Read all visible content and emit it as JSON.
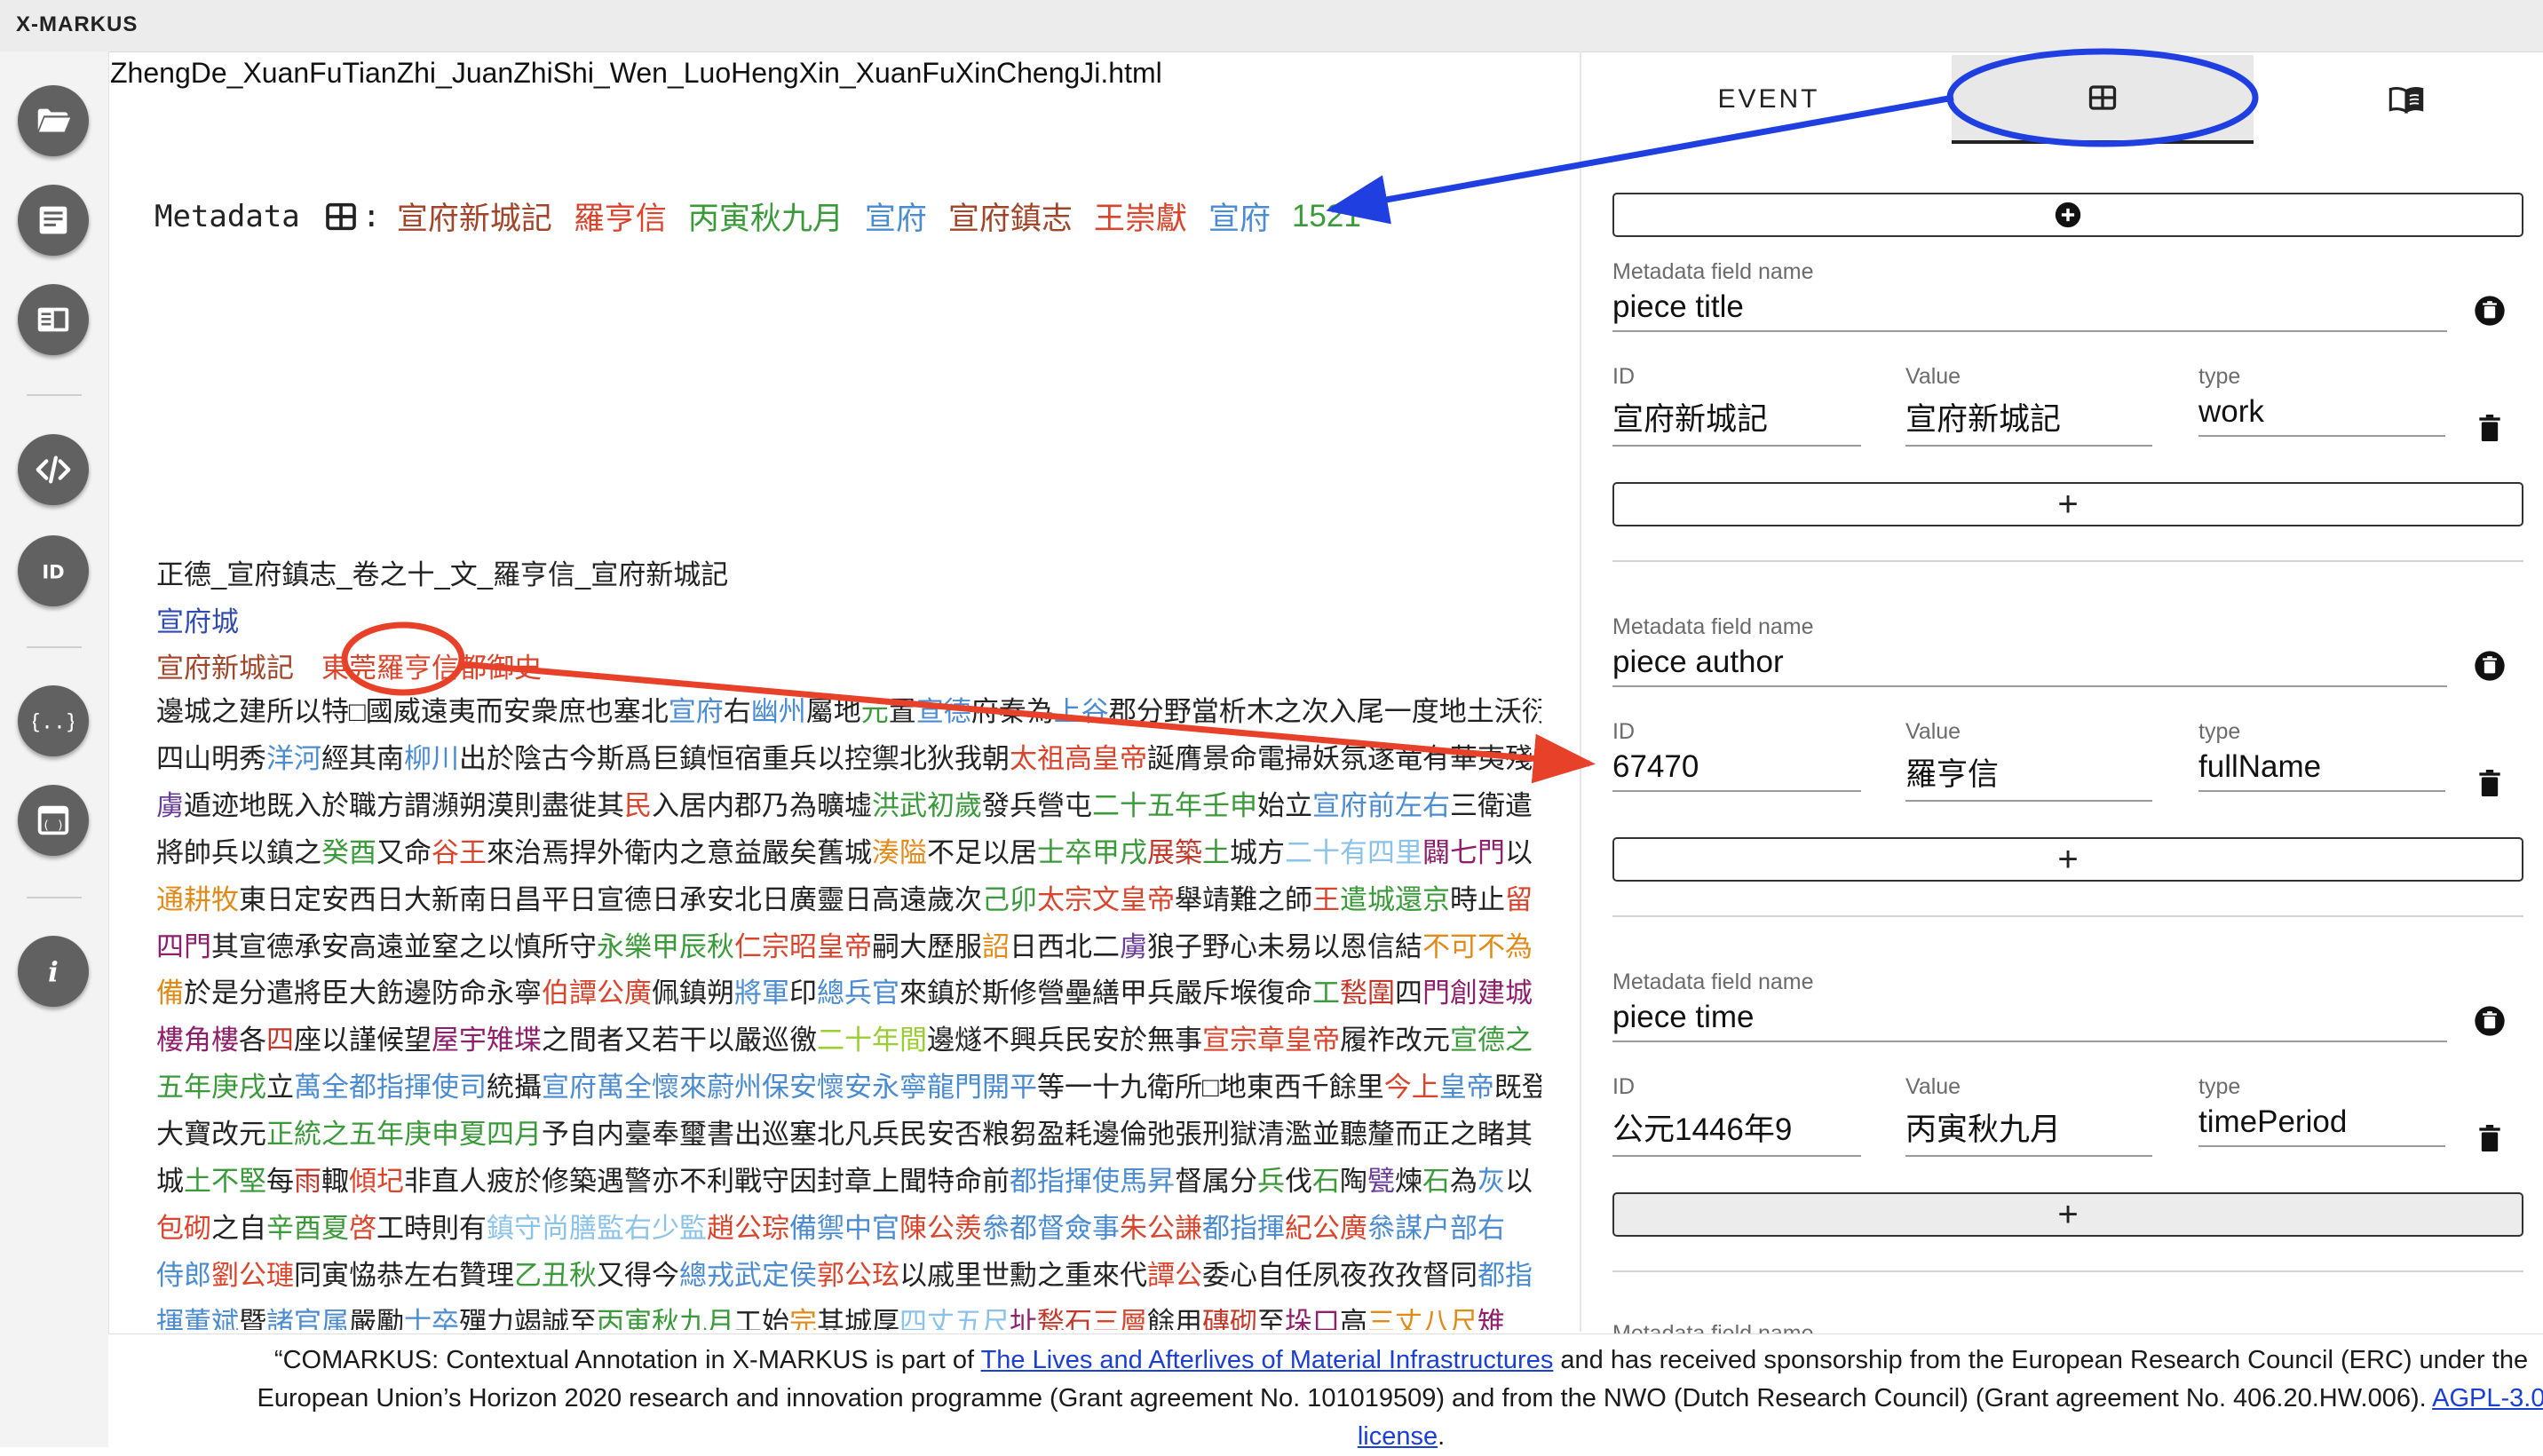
{
  "app": {
    "title": "X-MARKUS"
  },
  "sidebar": {
    "items": [
      {
        "name": "open-folder-button",
        "icon": "folder-open-icon"
      },
      {
        "name": "document-view-button",
        "icon": "article-icon"
      },
      {
        "name": "split-view-button",
        "icon": "book-view-icon"
      },
      {
        "name": "code-view-button",
        "icon": "code-icon"
      },
      {
        "name": "id-button",
        "icon": "id-icon"
      },
      {
        "name": "json-button",
        "icon": "curly-braces-icon"
      },
      {
        "name": "window-button",
        "icon": "window-icon"
      },
      {
        "name": "info-button",
        "icon": "info-icon"
      }
    ]
  },
  "document": {
    "filename": "ZhengDe_XuanFuTianZhi_JuanZhiShi_Wen_LuoHengXin_XuanFuXinChengJi.html",
    "metadata_label": "Metadata",
    "metadata_colon": ":",
    "metadata_tags": [
      {
        "text": "宣府新城記",
        "color": "#a0452a"
      },
      {
        "text": "羅亨信",
        "color": "#d8452c"
      },
      {
        "text": "丙寅秋九月",
        "color": "#3a9a3a"
      },
      {
        "text": "宣府",
        "color": "#4b8bd0"
      },
      {
        "text": "宣府鎮志",
        "color": "#a0452a"
      },
      {
        "text": "王崇獻",
        "color": "#d8452c"
      },
      {
        "text": "宣府",
        "color": "#4b8bd0"
      },
      {
        "text": "1521",
        "color": "#3a9a3a"
      }
    ],
    "title_line": "正德_宣府鎮志_卷之十_文_羅亨信_宣府新城記",
    "city": "宣府城",
    "subline": [
      {
        "text": "宣府新城記",
        "color": "#a0452a"
      },
      {
        "text": "　",
        "color": "#222222"
      },
      {
        "text": "東莞羅亨信都御史",
        "color": "#d8452c"
      }
    ],
    "body": [
      [
        {
          "t": "邊城之建所以特□國威遠夷而安衆庶也塞北",
          "c": "#222222"
        },
        {
          "t": "宣府",
          "c": "#4b8bd0"
        },
        {
          "t": "右",
          "c": "#222222"
        },
        {
          "t": "幽州",
          "c": "#4b8bd0"
        },
        {
          "t": "屬地",
          "c": "#222222"
        },
        {
          "t": "元",
          "c": "#3a9a3a"
        },
        {
          "t": "置",
          "c": "#222222"
        },
        {
          "t": "宣德",
          "c": "#4b8bd0"
        },
        {
          "t": "府秦為",
          "c": "#222222"
        },
        {
          "t": "上谷",
          "c": "#4b8bd0"
        },
        {
          "t": "郡分野當析木之次入尾一度地土沃衍",
          "c": "#222222"
        }
      ],
      [
        {
          "t": "四山明秀",
          "c": "#222222"
        },
        {
          "t": "洋河",
          "c": "#4b8bd0"
        },
        {
          "t": "經其南",
          "c": "#222222"
        },
        {
          "t": "柳川",
          "c": "#4b8bd0"
        },
        {
          "t": "出於陰古今斯爲巨鎮恒宿重兵以控禦北狄我朝",
          "c": "#222222"
        },
        {
          "t": "太祖高皇帝",
          "c": "#d8452c"
        },
        {
          "t": "誕膺景命電掃妖氛遂竜有華夷殘",
          "c": "#222222"
        }
      ],
      [
        {
          "t": "虜",
          "c": "#6a3d9a"
        },
        {
          "t": "遁迹地既入於職方謂瀕朔漠則盡徙其",
          "c": "#222222"
        },
        {
          "t": "民",
          "c": "#d8452c"
        },
        {
          "t": "入居内郡乃為曠墟",
          "c": "#222222"
        },
        {
          "t": "洪武初歲",
          "c": "#3a9a3a"
        },
        {
          "t": "發兵營屯",
          "c": "#222222"
        },
        {
          "t": "二十五年壬申",
          "c": "#3a9a3a"
        },
        {
          "t": "始立",
          "c": "#222222"
        },
        {
          "t": "宣府前左右",
          "c": "#4b8bd0"
        },
        {
          "t": "三衛遣",
          "c": "#222222"
        }
      ],
      [
        {
          "t": "將帥兵以鎮之",
          "c": "#222222"
        },
        {
          "t": "癸酉",
          "c": "#3a9a3a"
        },
        {
          "t": "又命",
          "c": "#222222"
        },
        {
          "t": "谷王",
          "c": "#d8452c"
        },
        {
          "t": "來治焉捍外衛内之意益嚴矣舊城",
          "c": "#222222"
        },
        {
          "t": "湊隘",
          "c": "#e08a1a"
        },
        {
          "t": "不足以居",
          "c": "#222222"
        },
        {
          "t": "士卒甲戌",
          "c": "#3a9a3a"
        },
        {
          "t": "展築",
          "c": "#c0392b"
        },
        {
          "t": "土",
          "c": "#3a9a3a"
        },
        {
          "t": "城方",
          "c": "#222222"
        },
        {
          "t": "二十有四里",
          "c": "#8bc3e8"
        },
        {
          "t": "闢七門",
          "c": "#8e1f6a"
        },
        {
          "t": "以",
          "c": "#222222"
        }
      ],
      [
        {
          "t": "通耕牧",
          "c": "#e08a1a"
        },
        {
          "t": "東日定安西日大新南日昌平日宣德日承安北日廣靈日高遠歲次",
          "c": "#222222"
        },
        {
          "t": "己卯",
          "c": "#3a9a3a"
        },
        {
          "t": "太宗文皇帝",
          "c": "#d8452c"
        },
        {
          "t": "舉靖難之師",
          "c": "#222222"
        },
        {
          "t": "王",
          "c": "#d8452c"
        },
        {
          "t": "遣城還京",
          "c": "#3a9a3a"
        },
        {
          "t": "時止",
          "c": "#222222"
        },
        {
          "t": "留",
          "c": "#d8452c"
        }
      ],
      [
        {
          "t": "四門",
          "c": "#8e1f6a"
        },
        {
          "t": "其宣德承安高遠並窒之以慎所守",
          "c": "#222222"
        },
        {
          "t": "永樂甲辰秋",
          "c": "#3a9a3a"
        },
        {
          "t": "仁宗昭皇帝",
          "c": "#d8452c"
        },
        {
          "t": "嗣大歷服",
          "c": "#222222"
        },
        {
          "t": "詔",
          "c": "#e08a1a"
        },
        {
          "t": "日西北二",
          "c": "#222222"
        },
        {
          "t": "虜",
          "c": "#6a3d9a"
        },
        {
          "t": "狼子野心未易以恩信結",
          "c": "#222222"
        },
        {
          "t": "不可不為",
          "c": "#e08a1a"
        }
      ],
      [
        {
          "t": "備",
          "c": "#e08a1a"
        },
        {
          "t": "於是分遣將臣大飭邊防命永寧",
          "c": "#222222"
        },
        {
          "t": "伯譚公廣",
          "c": "#d8452c"
        },
        {
          "t": "佩鎮朔",
          "c": "#222222"
        },
        {
          "t": "將軍",
          "c": "#4b8bd0"
        },
        {
          "t": "印",
          "c": "#222222"
        },
        {
          "t": "總兵官",
          "c": "#4b8bd0"
        },
        {
          "t": "來鎮於斯修營壘繕甲兵嚴斥堠復命",
          "c": "#222222"
        },
        {
          "t": "工",
          "c": "#3a9a3a"
        },
        {
          "t": "甃圍",
          "c": "#c0392b"
        },
        {
          "t": "四",
          "c": "#222222"
        },
        {
          "t": "門",
          "c": "#8e1f6a"
        },
        {
          "t": "創建城",
          "c": "#8e1f6a"
        }
      ],
      [
        {
          "t": "樓角樓",
          "c": "#8e1f6a"
        },
        {
          "t": "各",
          "c": "#222222"
        },
        {
          "t": "四",
          "c": "#c0392b"
        },
        {
          "t": "座以謹候望",
          "c": "#222222"
        },
        {
          "t": "屋宇雉堞",
          "c": "#8e1f6a"
        },
        {
          "t": "之間者又若干以嚴巡徼",
          "c": "#222222"
        },
        {
          "t": "二十年間",
          "c": "#9acd32"
        },
        {
          "t": "邊燧不興兵民安於無事",
          "c": "#222222"
        },
        {
          "t": "宣宗章皇帝",
          "c": "#d8452c"
        },
        {
          "t": "履祚改元",
          "c": "#222222"
        },
        {
          "t": "宣德之",
          "c": "#3a9a3a"
        }
      ],
      [
        {
          "t": "五年庚戌",
          "c": "#3a9a3a"
        },
        {
          "t": "立",
          "c": "#222222"
        },
        {
          "t": "萬全都指揮使司",
          "c": "#4b8bd0"
        },
        {
          "t": "統攝",
          "c": "#222222"
        },
        {
          "t": "宣府萬全懷來蔚州保安懷安永寧龍門開平",
          "c": "#4b8bd0"
        },
        {
          "t": "等一十九衛所□地東西千餘里",
          "c": "#222222"
        },
        {
          "t": "今上",
          "c": "#d8452c"
        },
        {
          "t": "皇帝",
          "c": "#4b8bd0"
        },
        {
          "t": "既登",
          "c": "#222222"
        }
      ],
      [
        {
          "t": "大寶改元",
          "c": "#222222"
        },
        {
          "t": "正統之五年庚申夏四月",
          "c": "#3a9a3a"
        },
        {
          "t": "予自内臺奉璽書出巡塞北凡兵民安否粮芻盈耗邊倫弛張刑獄清濫並聽釐而正之睹其",
          "c": "#222222"
        }
      ],
      [
        {
          "t": "城",
          "c": "#222222"
        },
        {
          "t": "土不堅",
          "c": "#3a9a3a"
        },
        {
          "t": "每",
          "c": "#222222"
        },
        {
          "t": "雨",
          "c": "#c0392b"
        },
        {
          "t": "輙",
          "c": "#222222"
        },
        {
          "t": "傾圮",
          "c": "#d8452c"
        },
        {
          "t": "非直人疲於修築遇警亦不利戰守因封章上聞特命前",
          "c": "#222222"
        },
        {
          "t": "都指揮使馬昇",
          "c": "#4b8bd0"
        },
        {
          "t": "督属分",
          "c": "#222222"
        },
        {
          "t": "兵",
          "c": "#3a9a3a"
        },
        {
          "t": "伐",
          "c": "#222222"
        },
        {
          "t": "石",
          "c": "#3a9a3a"
        },
        {
          "t": "陶",
          "c": "#222222"
        },
        {
          "t": "甓",
          "c": "#6a3d9a"
        },
        {
          "t": "煉",
          "c": "#222222"
        },
        {
          "t": "石",
          "c": "#3a9a3a"
        },
        {
          "t": "為",
          "c": "#222222"
        },
        {
          "t": "灰",
          "c": "#4b8bd0"
        },
        {
          "t": "以",
          "c": "#222222"
        }
      ],
      [
        {
          "t": "包砌",
          "c": "#d8452c"
        },
        {
          "t": "之自",
          "c": "#222222"
        },
        {
          "t": "辛酉夏",
          "c": "#3a9a3a"
        },
        {
          "t": "啓",
          "c": "#d8452c"
        },
        {
          "t": "工時則有",
          "c": "#222222"
        },
        {
          "t": "鎮守尚膳監右少監",
          "c": "#8bc3e8"
        },
        {
          "t": "趙公琮",
          "c": "#d8452c"
        },
        {
          "t": "備禦中官",
          "c": "#4b8bd0"
        },
        {
          "t": "陳公羨",
          "c": "#d8452c"
        },
        {
          "t": "叅都督僉事",
          "c": "#4b8bd0"
        },
        {
          "t": "朱公謙",
          "c": "#d8452c"
        },
        {
          "t": "都指揮",
          "c": "#4b8bd0"
        },
        {
          "t": "紀公廣",
          "c": "#d8452c"
        },
        {
          "t": "叅謀户部右",
          "c": "#4b8bd0"
        }
      ],
      [
        {
          "t": "侍郎",
          "c": "#4b8bd0"
        },
        {
          "t": "劉公璉",
          "c": "#d8452c"
        },
        {
          "t": "同寅恊恭左右贊理",
          "c": "#222222"
        },
        {
          "t": "乙丑秋",
          "c": "#3a9a3a"
        },
        {
          "t": "又得今",
          "c": "#222222"
        },
        {
          "t": "總戎武定侯",
          "c": "#4b8bd0"
        },
        {
          "t": "郭公玹",
          "c": "#d8452c"
        },
        {
          "t": "以戚里世勳之重來代",
          "c": "#222222"
        },
        {
          "t": "譚公",
          "c": "#d8452c"
        },
        {
          "t": "委心自任夙夜孜孜督同",
          "c": "#222222"
        },
        {
          "t": "都指",
          "c": "#4b8bd0"
        }
      ],
      [
        {
          "t": "揮董斌",
          "c": "#4b8bd0"
        },
        {
          "t": "暨",
          "c": "#222222"
        },
        {
          "t": "諸官属",
          "c": "#4b8bd0"
        },
        {
          "t": "嚴勵",
          "c": "#222222"
        },
        {
          "t": "士卒",
          "c": "#4b8bd0"
        },
        {
          "t": "殫力竭誠至",
          "c": "#222222"
        },
        {
          "t": "丙寅秋九月",
          "c": "#3a9a3a"
        },
        {
          "t": "工始",
          "c": "#222222"
        },
        {
          "t": "完",
          "c": "#e08a1a"
        },
        {
          "t": "其城厚",
          "c": "#222222"
        },
        {
          "t": "四丈五尺",
          "c": "#8bc3e8"
        },
        {
          "t": "址",
          "c": "#8e1f6a"
        },
        {
          "t": "甃石",
          "c": "#c0392b"
        },
        {
          "t": "三層",
          "c": "#d8452c"
        },
        {
          "t": "餘用",
          "c": "#222222"
        },
        {
          "t": "磚砌",
          "c": "#c0392b"
        },
        {
          "t": "至",
          "c": "#222222"
        },
        {
          "t": "垛口",
          "c": "#8e1f6a"
        },
        {
          "t": "高",
          "c": "#222222"
        },
        {
          "t": "三丈八尺",
          "c": "#e08a1a"
        },
        {
          "t": "雉",
          "c": "#8e1f6a"
        }
      ]
    ]
  },
  "panel": {
    "tabs": [
      {
        "label": "EVENT",
        "icon": ""
      },
      {
        "label": "",
        "icon": "table-icon"
      },
      {
        "label": "",
        "icon": "book-icon"
      }
    ],
    "field_name_label": "Metadata field name",
    "id_label": "ID",
    "value_label": "Value",
    "type_label": "type",
    "add_symbol": "+",
    "fields": [
      {
        "name": "piece title",
        "id": "宣府新城記",
        "value": "宣府新城記",
        "type": "work"
      },
      {
        "name": "piece author",
        "id": "67470",
        "value": "羅亨信",
        "type": "fullName"
      },
      {
        "name": "piece time",
        "id": "公元1446年9",
        "value": "丙寅秋九月",
        "type": "timePeriod"
      }
    ],
    "next_field_label_partial": "Metadata field name"
  },
  "footer": {
    "text_before": "“COMARKUS: Contextual Annotation in X-MARKUS is part of ",
    "link1": "The Lives and Afterlives of Material Infrastructures",
    "text_middle": " and has received sponsorship from the European Research Council (ERC) under the European Union’s Horizon 2020 research and innovation programme (Grant agreement No. 101019509) and from the NWO (Dutch Research Council) (Grant agreement No. 406.20.HW.006). ",
    "link2": "AGPL-3.0 license",
    "text_after": "."
  },
  "colors": {
    "sidebar_button": "#616161",
    "annotation_blue": "#1f3fe0",
    "annotation_red": "#e8412a"
  }
}
